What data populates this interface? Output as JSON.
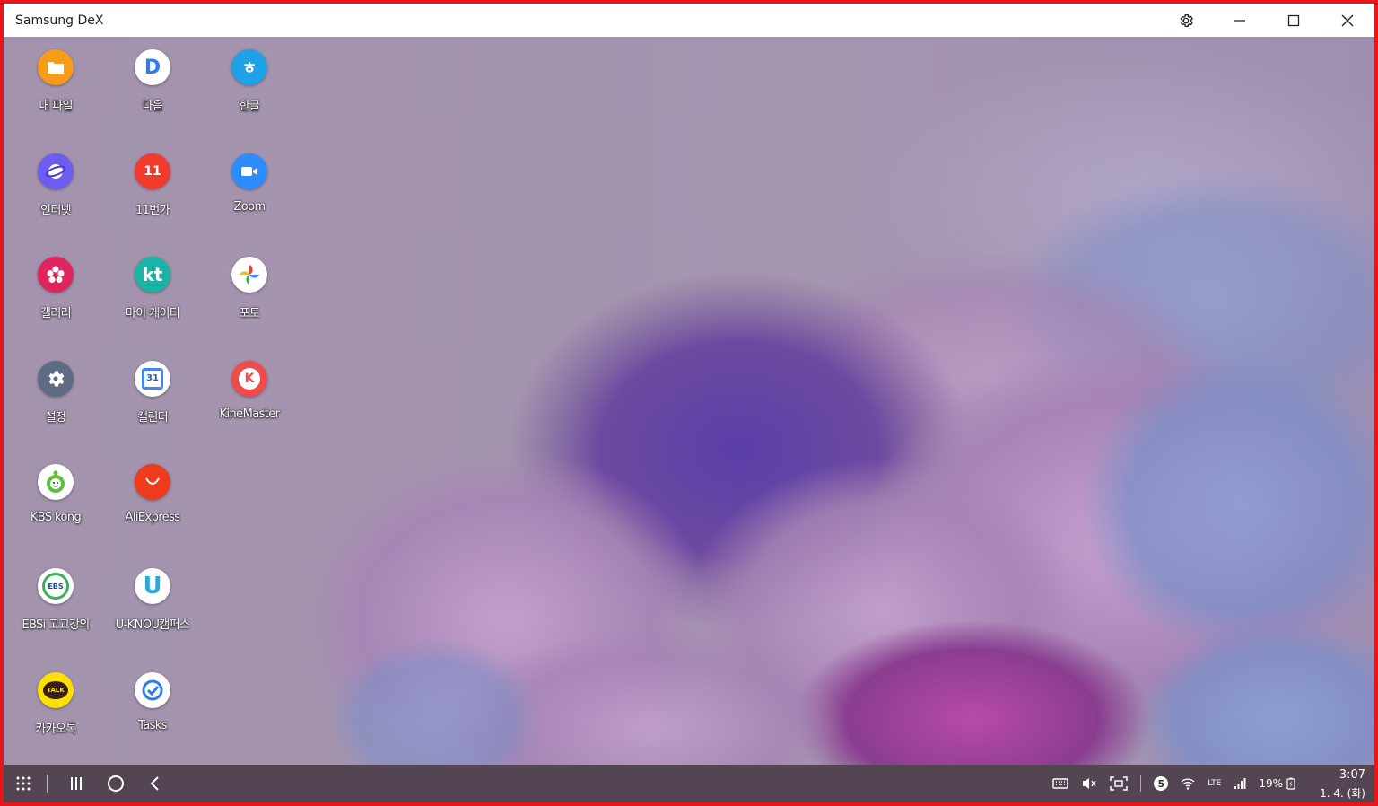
{
  "window": {
    "title": "Samsung DeX"
  },
  "apps": [
    {
      "label": "내 파일",
      "icon": "my-files-icon",
      "color": "#f59d1a"
    },
    {
      "label": "다음",
      "icon": "daum-icon",
      "color": "#ffffff"
    },
    {
      "label": "한글",
      "icon": "hangul-icon",
      "color": "#1fa1e6"
    },
    {
      "label": "인터넷",
      "icon": "internet-icon",
      "color": "#6a5df0"
    },
    {
      "label": "11번가",
      "icon": "11st-icon",
      "color": "#f23a2d"
    },
    {
      "label": "Zoom",
      "icon": "zoom-icon",
      "color": "#2d8cff"
    },
    {
      "label": "갤러리",
      "icon": "gallery-icon",
      "color": "#e0245e"
    },
    {
      "label": "마이 케이티",
      "icon": "my-kt-icon",
      "color": "#1bb3a6"
    },
    {
      "label": "포토",
      "icon": "google-photos-icon",
      "color": "#ffffff"
    },
    {
      "label": "설정",
      "icon": "settings-gear-icon",
      "color": "#5e6b85"
    },
    {
      "label": "캘린더",
      "icon": "google-calendar-icon",
      "color": "#ffffff"
    },
    {
      "label": "KineMaster",
      "icon": "kinemaster-icon",
      "color": "#f04b4b"
    },
    {
      "label": "KBS kong",
      "icon": "kbs-kong-icon",
      "color": "#ffffff"
    },
    {
      "label": "AliExpress",
      "icon": "aliexpress-icon",
      "color": "#ee3b1d"
    },
    {
      "label": "EBSi 고교강의",
      "icon": "ebsi-icon",
      "color": "#ffffff"
    },
    {
      "label": "U-KNOU캠퍼스",
      "icon": "u-knou-icon",
      "color": "#ffffff"
    },
    {
      "label": "카카오톡",
      "icon": "kakaotalk-icon",
      "color": "#fae100"
    },
    {
      "label": "Tasks",
      "icon": "google-tasks-icon",
      "color": "#ffffff"
    }
  ],
  "icon_text": {
    "daum": "D",
    "hangul": "ㅎ",
    "st11": "11",
    "kt": "kt",
    "calendar": "31",
    "kine": "K",
    "ebs": "EBS",
    "knou": "U",
    "kakao": "TALK"
  },
  "tray": {
    "notification_count": "5",
    "network": "LTE",
    "battery": "19%"
  },
  "clock": {
    "time": "3:07",
    "date": "1. 4. (화)"
  }
}
